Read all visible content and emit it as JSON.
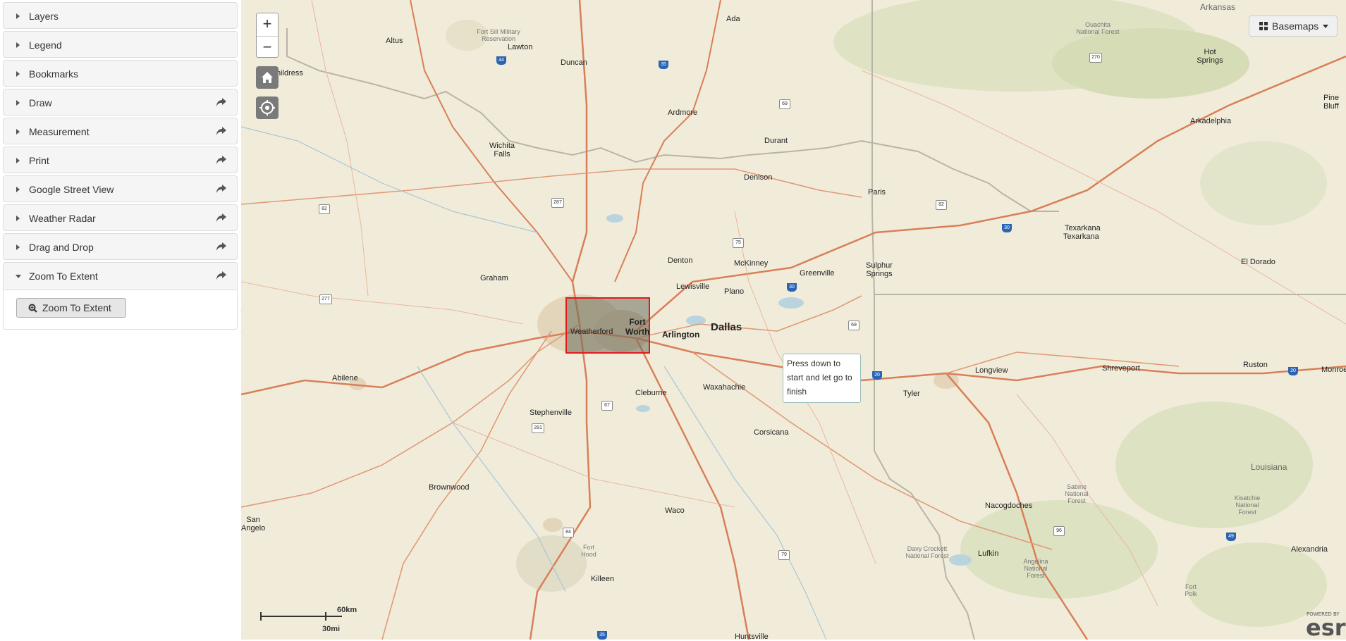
{
  "sidebar": {
    "panels": [
      {
        "title": "Layers",
        "share": false,
        "expanded": false
      },
      {
        "title": "Legend",
        "share": false,
        "expanded": false
      },
      {
        "title": "Bookmarks",
        "share": false,
        "expanded": false
      },
      {
        "title": "Draw",
        "share": true,
        "expanded": false
      },
      {
        "title": "Measurement",
        "share": true,
        "expanded": false
      },
      {
        "title": "Print",
        "share": true,
        "expanded": false
      },
      {
        "title": "Google Street View",
        "share": true,
        "expanded": false
      },
      {
        "title": "Weather Radar",
        "share": true,
        "expanded": false
      },
      {
        "title": "Drag and Drop",
        "share": true,
        "expanded": false
      },
      {
        "title": "Zoom To Extent",
        "share": true,
        "expanded": true
      }
    ],
    "zoom_extent_button": "Zoom To Extent"
  },
  "map": {
    "zoom_in": "+",
    "zoom_out": "−",
    "basemaps_label": "Basemaps",
    "tooltip": "Press down to start and let go to finish",
    "scale": {
      "km": "60km",
      "mi": "30mi"
    },
    "attribution": {
      "powered": "POWERED BY",
      "logo": "esri"
    },
    "labels": {
      "ada": "Ada",
      "altus": "Altus",
      "lawton": "Lawton",
      "fort_sill": "Fort Sill Military Reservation",
      "duncan": "Duncan",
      "childress": "Childress",
      "ardmore": "Ardmore",
      "durant": "Durant",
      "wichita_falls": "Wichita Falls",
      "denison": "Denison",
      "paris": "Paris",
      "arkansas": "Arkansas",
      "ouachita": "Ouachita National Forest",
      "hot_springs": "Hot Springs",
      "pine_bluff": "Pine Bluff",
      "arkadelphia": "Arkadelphia",
      "texarkana_1": "Texarkana",
      "texarkana_2": "Texarkana",
      "el_dorado": "El Dorado",
      "denton": "Denton",
      "mckinney": "McKinney",
      "graham": "Graham",
      "lewisville": "Lewisville",
      "plano": "Plano",
      "greenville": "Greenville",
      "sulphur_springs": "Sulphur Springs",
      "fort_worth": "Fort Worth",
      "arlington": "Arlington",
      "dallas": "Dallas",
      "weatherford": "Weatherford",
      "abilene": "Abilene",
      "cleburne": "Cleburne",
      "waxahachie": "Waxahachie",
      "longview": "Longview",
      "shreveport": "Shreveport",
      "ruston": "Ruston",
      "monroe": "Monroe",
      "tyler": "Tyler",
      "stephenville": "Stephenville",
      "corsicana": "Corsicana",
      "brownwood": "Brownwood",
      "san_angelo": "San Angelo",
      "waco": "Waco",
      "sabine": "Sabine National Forest",
      "louisiana": "Louisiana",
      "kisatchie": "Kisatchie National Forest",
      "nacogdoches": "Nacogdoches",
      "fort_hood": "Fort Hood",
      "killeen": "Killeen",
      "davy_crockett": "Davy Crockett National Forest",
      "lufkin": "Lufkin",
      "angelina": "Angelina National Forest",
      "alexandria": "Alexandria",
      "fort_polk": "Fort Polk",
      "huntsville": "Huntsville"
    },
    "shields": {
      "i44": "44",
      "i35": "35",
      "us69": "69",
      "us82a": "82",
      "us287": "287",
      "us75": "75",
      "i30a": "30",
      "us82b": "82",
      "us270": "270",
      "i30b": "30",
      "us277": "277",
      "us69b": "69",
      "i20a": "20",
      "i20b": "20",
      "us67": "67",
      "us281": "281",
      "us84": "84",
      "us79": "79",
      "us96": "96",
      "i49": "49",
      "i35b": "35"
    }
  }
}
